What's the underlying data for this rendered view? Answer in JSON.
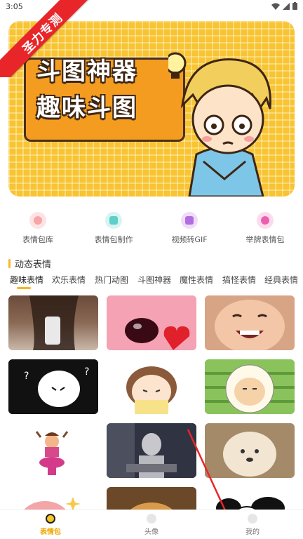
{
  "status_bar": {
    "time": "3:05"
  },
  "ribbon": {
    "text": "圣力专测"
  },
  "banner": {
    "title_line1": "斗图神器",
    "title_line2": "趣味斗图"
  },
  "categories": [
    {
      "label": "表情包库",
      "color": "#f7a5a5"
    },
    {
      "label": "表情包制作",
      "color": "#5ccfc7"
    },
    {
      "label": "视频转GIF",
      "color": "#b06de0"
    },
    {
      "label": "举牌表情包",
      "color": "#ec5fb0"
    }
  ],
  "section": {
    "title": "动态表情"
  },
  "tabs": [
    {
      "label": "趣味表情",
      "active": true
    },
    {
      "label": "欢乐表情",
      "active": false
    },
    {
      "label": "热门动图",
      "active": false
    },
    {
      "label": "斗图神器",
      "active": false
    },
    {
      "label": "魔性表情",
      "active": false
    },
    {
      "label": "搞怪表情",
      "active": false
    },
    {
      "label": "经典表情",
      "active": false
    }
  ],
  "bottom_nav": [
    {
      "label": "表情包",
      "icon": "emoji-icon",
      "active": true
    },
    {
      "label": "头像",
      "icon": "avatar-icon",
      "active": false
    },
    {
      "label": "我的",
      "icon": "profile-icon",
      "active": false
    }
  ],
  "colors": {
    "accent": "#f5b91f",
    "banner_bg": "#f8c431",
    "ribbon": "#e8262a"
  }
}
